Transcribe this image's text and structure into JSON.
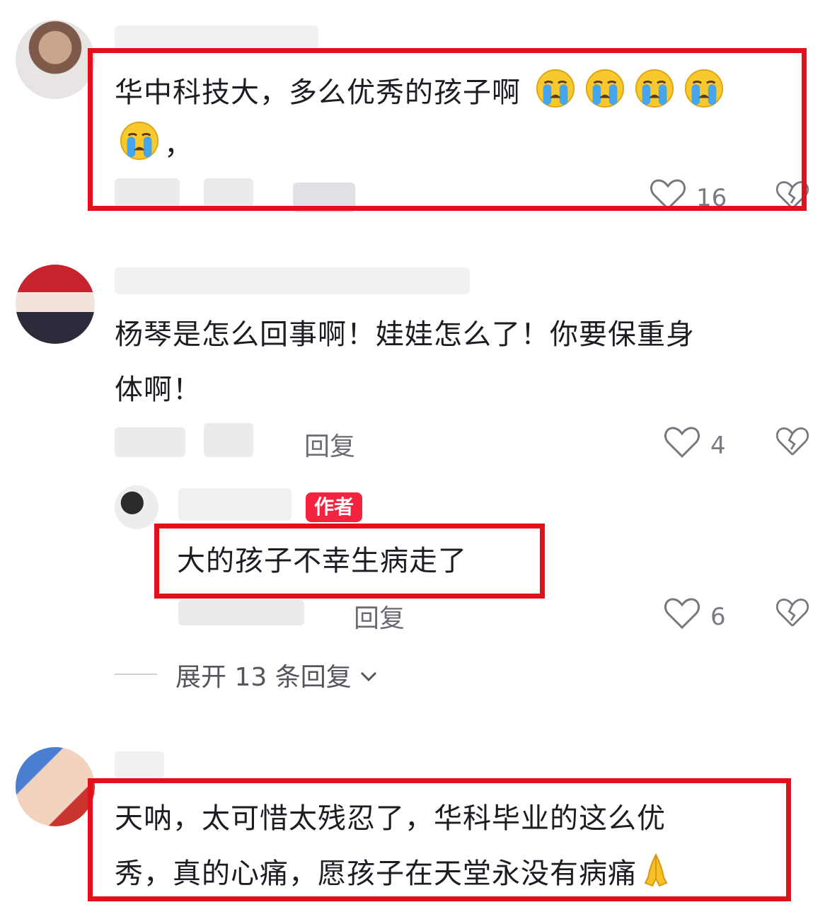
{
  "comments": [
    {
      "text_line1": "华中科技大，多么优秀的孩子啊",
      "emoji_icon": "loudly-crying-face-emoji",
      "emoji_count": 5,
      "text_tail": "，",
      "likes": "16"
    },
    {
      "text_line1": "杨琴是怎么回事啊！娃娃怎么了！你要保重身",
      "text_line2": "体啊！",
      "reply_label": "回复",
      "likes": "4",
      "author_reply": {
        "tag": "作者",
        "text": "大的孩子不幸生病走了",
        "reply_label": "回复",
        "likes": "6"
      },
      "expand_label": "展开 13 条回复"
    },
    {
      "text_line1": "天呐，太可惜太残忍了，华科毕业的这么优",
      "text_line2": "秀，真的心痛，愿孩子在天堂永没有病痛",
      "emoji_icon": "folded-hands-emoji"
    }
  ],
  "colors": {
    "highlight": "#e3101b",
    "author_tag": "#f4233f",
    "muted_text": "#7a7a82"
  }
}
